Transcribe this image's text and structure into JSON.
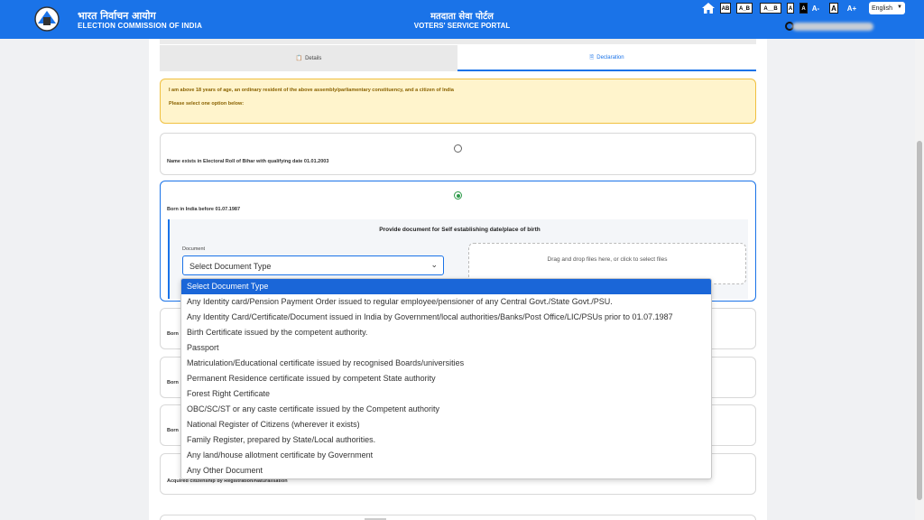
{
  "header": {
    "brand_hindi": "भारत निर्वाचन आयोग",
    "brand_english": "ELECTION COMMISSION OF INDIA",
    "portal_hindi": "मतदाता सेवा पोर्टल",
    "portal_english": "VOTERS' SERVICE PORTAL",
    "font_controls": [
      "AB",
      "A_B",
      "A__B",
      "A",
      "A",
      "A-",
      "A",
      "A+"
    ],
    "language": "English"
  },
  "tabs": [
    {
      "label": "Details",
      "icon": "clipboard-icon",
      "active": false
    },
    {
      "label": "Declaration",
      "icon": "document-icon",
      "active": true
    }
  ],
  "declaration": {
    "statement": "I am above 18 years of age, an ordinary resident of the above assembly/parliamentary constituency, and a citizen of India",
    "instruction": "Please select one option below:"
  },
  "options": [
    {
      "label": "Name exists in Electoral Roll of Bihar with qualifying date 01.01.2003",
      "selected": false
    },
    {
      "label": "Born in India before 01.07.1987",
      "selected": true
    },
    {
      "label": "Born",
      "selected": false
    },
    {
      "label": "Born",
      "selected": false
    },
    {
      "label": "Born",
      "selected": false
    },
    {
      "label": "Acquired citizenship by Registration/Naturalisation",
      "selected": false
    }
  ],
  "document_section": {
    "title": "Provide document for Self establishing date/place of birth",
    "field_label": "Document",
    "selected_value": "Select Document Type",
    "dropzone_text": "Drag and drop files here, or click to select files"
  },
  "document_types": [
    "Select Document Type",
    "Any Identity card/Pension Payment Order issued to regular employee/pensioner of any Central Govt./State Govt./PSU.",
    "Any Identity Card/Certificate/Document issued in India by Government/local authorities/Banks/Post Office/LIC/PSUs prior to 01.07.1987",
    "Birth Certificate issued by the competent authority.",
    "Passport",
    "Matriculation/Educational certificate issued by recognised Boards/universities",
    "Permanent Residence certificate issued by competent State authority",
    "Forest Right Certificate",
    "OBC/SC/ST or any caste certificate issued by the Competent authority",
    "National Register of Citizens (wherever it exists)",
    "Family Register, prepared by State/Local authorities.",
    "Any land/house allotment certificate by Government",
    "Any Other Document"
  ],
  "colors": {
    "header_bg": "#1a73e8",
    "accent": "#1a73e8",
    "notice_bg": "#fff4cc",
    "notice_border": "#f0c040",
    "selected_radio": "#2e9a4a",
    "highlight_option": "#1a66d8"
  }
}
